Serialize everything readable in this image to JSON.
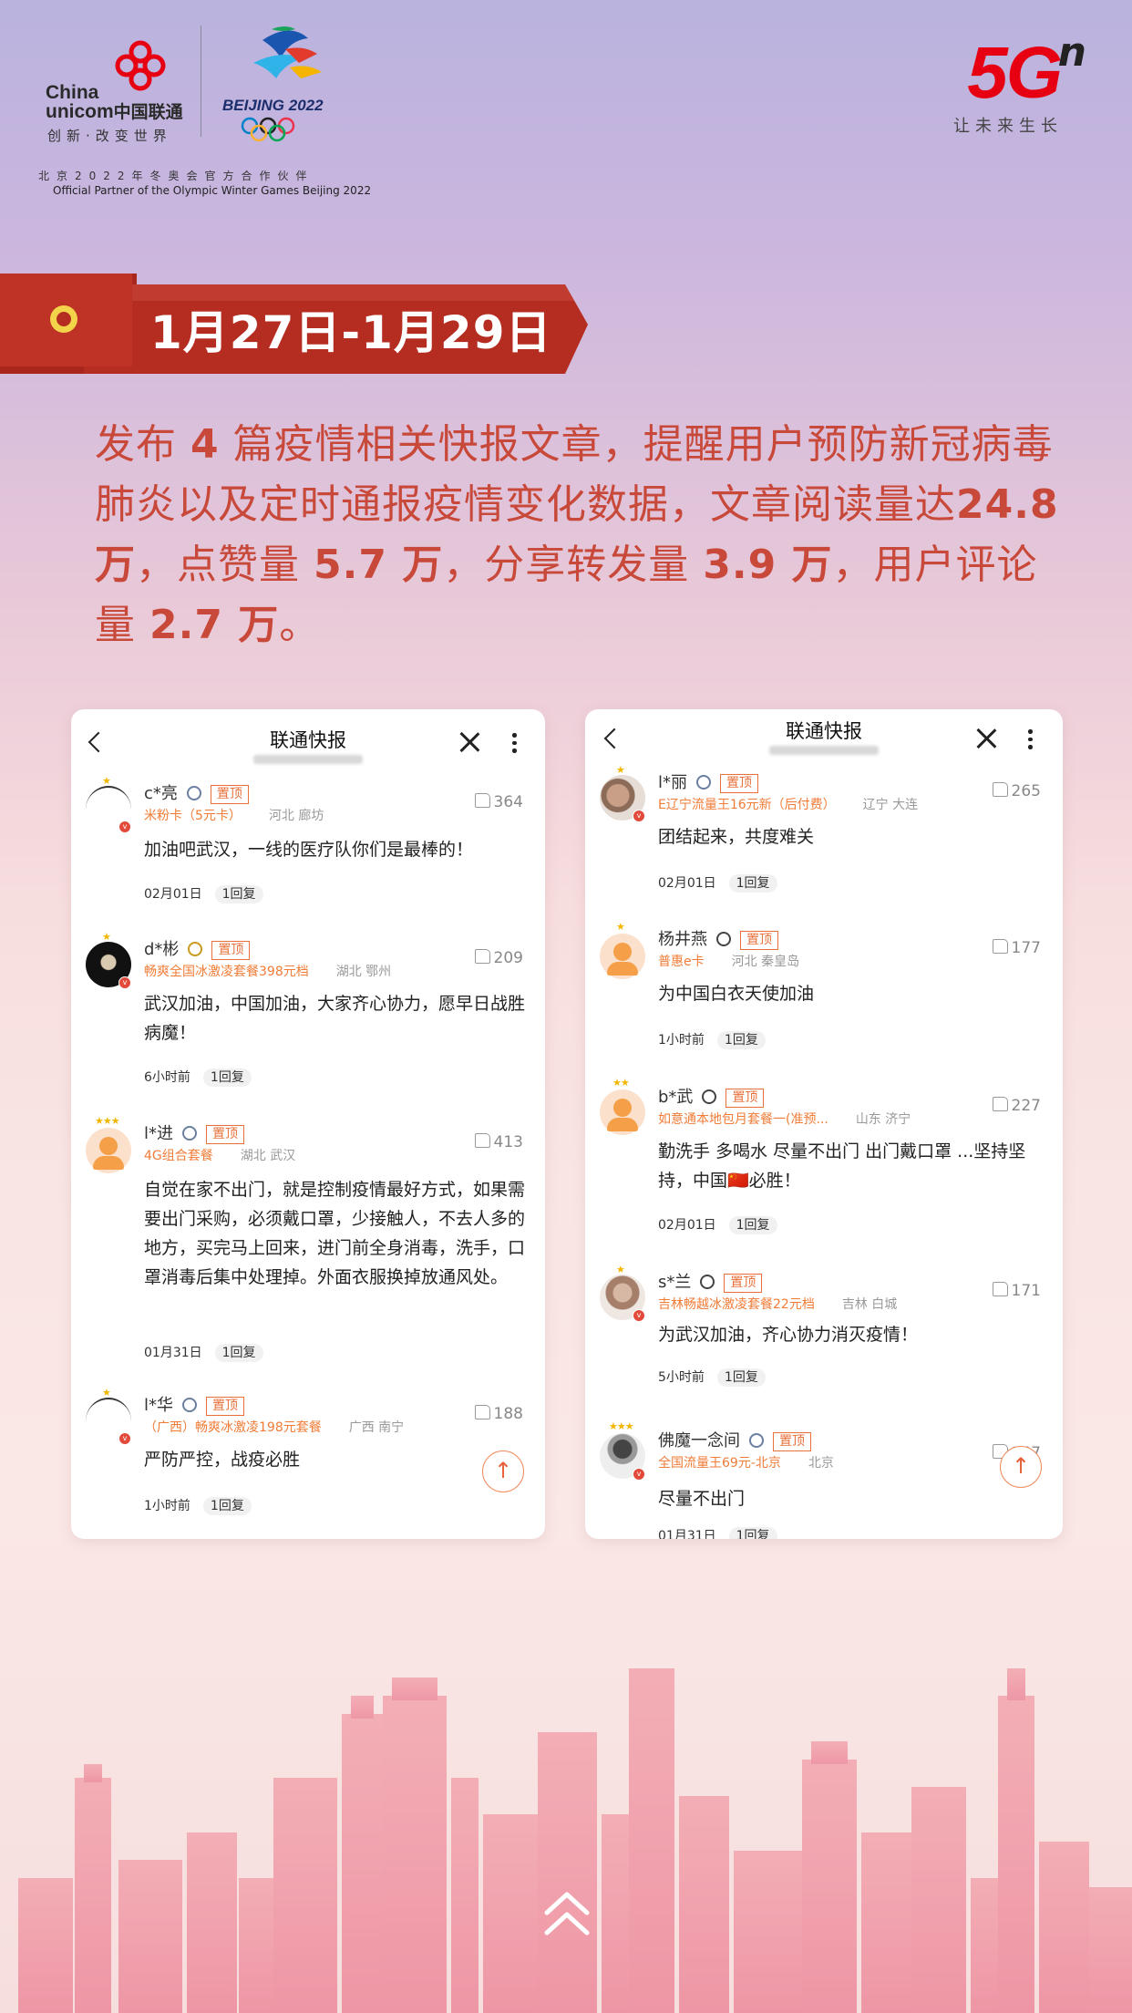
{
  "brand": {
    "unicom_cn": "中国联通",
    "unicom_en_line1": "China",
    "unicom_en_line2": "unicom",
    "unicom_slogan": "创新·改变世界",
    "olympic_text": "BEIJING 2022",
    "partner_cn": "北京2022年冬奥会官方合作伙伴",
    "partner_en": "Official Partner of the Olympic Winter Games Beijing 2022",
    "five_g": "5G",
    "five_g_sup": "n",
    "five_g_slogan": "让未来生长"
  },
  "banner": {
    "date_range": "1月27日-1月29日"
  },
  "summary": {
    "p1": "发布 ",
    "n1": "4",
    "p2": " 篇疫情相关快报文章，提醒用户预防新冠病毒肺炎以及定时通报疫情变化数据，文章阅读量达",
    "n2": "24.8 万",
    "p3": "，点赞量 ",
    "n3": "5.7 万",
    "p4": "，分享转发量 ",
    "n4": "3.9 万",
    "p5": "，用户评论量 ",
    "n5": "2.7 万",
    "p6": "。"
  },
  "left_card": {
    "title": "联通快报",
    "comments": [
      {
        "user": "c*亮",
        "tag": "置顶",
        "plan": "米粉卡（5元卡）",
        "location": "河北 廊坊",
        "likes": "364",
        "text": "加油吧武汉，一线的医疗队你们是最棒的！",
        "time": "02月01日",
        "reply": "1回复"
      },
      {
        "user": "d*彬",
        "tag": "置顶",
        "plan": "畅爽全国冰激凌套餐398元档",
        "location": "湖北 鄂州",
        "likes": "209",
        "text": "武汉加油，中国加油，大家齐心协力，愿早日战胜病魔！",
        "time": "6小时前",
        "reply": "1回复"
      },
      {
        "user": "l*进",
        "tag": "置顶",
        "plan": "4G组合套餐",
        "location": "湖北 武汉",
        "likes": "413",
        "text": "自觉在家不出门，就是控制疫情最好方式，如果需要出门采购，必须戴口罩，少接触人，不去人多的地方，买完马上回来，进门前全身消毒，洗手，口罩消毒后集中处理掉。外面衣服换掉放通风处。",
        "time": "01月31日",
        "reply": "1回复"
      },
      {
        "user": "l*华",
        "tag": "置顶",
        "plan": "（广西）畅爽冰激凌198元套餐",
        "location": "广西 南宁",
        "likes": "188",
        "text": "严防严控，战疫必胜",
        "time": "1小时前",
        "reply": "1回复"
      }
    ]
  },
  "right_card": {
    "title": "联通快报",
    "comments": [
      {
        "user": "l*丽",
        "tag": "置顶",
        "plan": "E辽宁流量王16元新（后付费）",
        "location": "辽宁 大连",
        "likes": "265",
        "text": "团结起来，共度难关",
        "time": "02月01日",
        "reply": "1回复"
      },
      {
        "user": "杨井燕",
        "tag": "置顶",
        "plan": "普惠e卡",
        "location": "河北 秦皇岛",
        "likes": "177",
        "text": "为中国白衣天使加油",
        "time": "1小时前",
        "reply": "1回复"
      },
      {
        "user": "b*武",
        "tag": "置顶",
        "plan": "如意通本地包月套餐一(准预...",
        "location": "山东 济宁",
        "likes": "227",
        "text": "勤洗手 多喝水 尽量不出门 出门戴口罩 ...坚持坚持，中国🇨🇳必胜！",
        "time": "02月01日",
        "reply": "1回复"
      },
      {
        "user": "s*兰",
        "tag": "置顶",
        "plan": "吉林畅越冰激凌套餐22元档",
        "location": "吉林 白城",
        "likes": "171",
        "text": "为武汉加油，齐心协力消灭疫情！",
        "time": "5小时前",
        "reply": "1回复"
      },
      {
        "user": "佛魔一念间",
        "tag": "置顶",
        "plan": "全国流量王69元-北京",
        "location": "北京",
        "likes": "147",
        "text": "尽量不出门",
        "time": "01月31日",
        "reply": "1回复"
      }
    ]
  },
  "colors": {
    "accent_red": "#c8493a",
    "ribbon_red": "#b02a1e",
    "five_g_red": "#e60012",
    "tag_orange": "#e8703a",
    "skyline_pink": "#f0a2ad"
  },
  "icons": [
    "back-icon",
    "close-icon",
    "more-icon",
    "thumbs-up-icon",
    "scroll-top-icon",
    "chevrons-up-icon"
  ]
}
